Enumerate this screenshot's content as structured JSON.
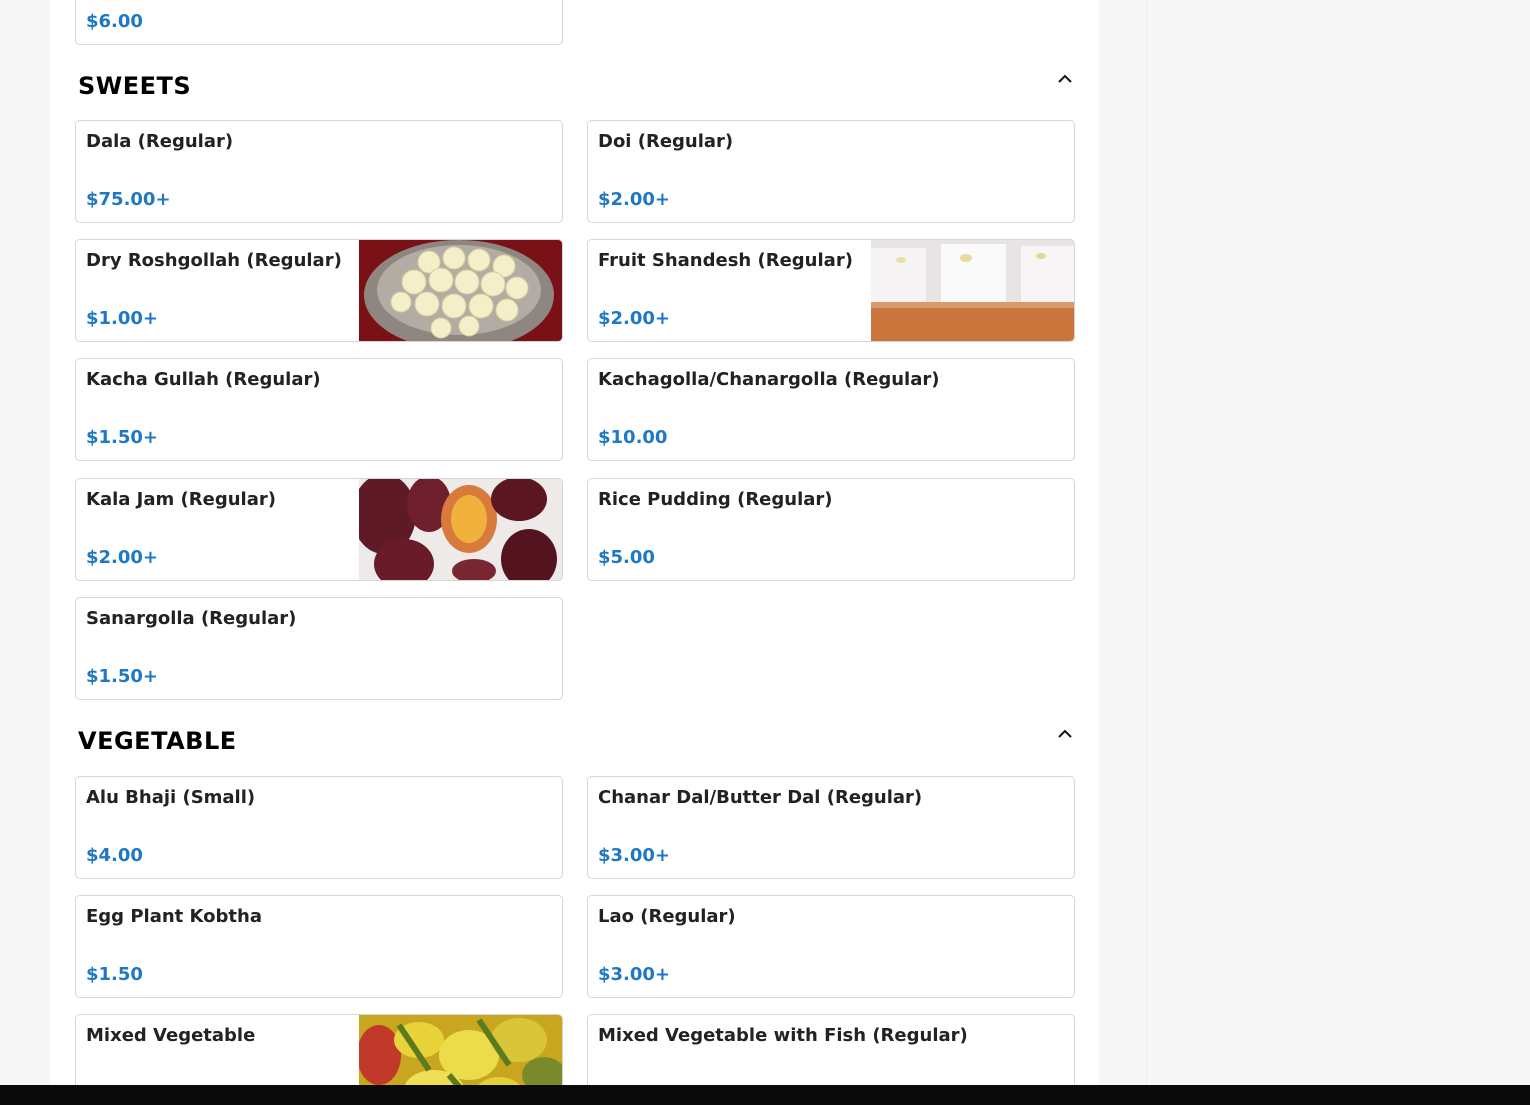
{
  "partial_top": {
    "price": "$6.00"
  },
  "sections": {
    "sweets": {
      "title": "SWEETS",
      "items": [
        {
          "name": "Dala (Regular)",
          "price": "$75.00+"
        },
        {
          "name": "Doi (Regular)",
          "price": "$2.00+"
        },
        {
          "name": "Dry Roshgollah (Regular)",
          "price": "$1.00+",
          "image": "roshgollah-photo"
        },
        {
          "name": "Fruit Shandesh (Regular)",
          "price": "$2.00+",
          "image": "shandesh-photo"
        },
        {
          "name": "Kacha Gullah (Regular)",
          "price": "$1.50+"
        },
        {
          "name": "Kachagolla/Chanargolla (Regular)",
          "price": "$10.00"
        },
        {
          "name": "Kala Jam (Regular)",
          "price": "$2.00+",
          "image": "kala-jam-photo"
        },
        {
          "name": "Rice Pudding (Regular)",
          "price": "$5.00"
        },
        {
          "name": "Sanargolla (Regular)",
          "price": "$1.50+"
        }
      ]
    },
    "vegetable": {
      "title": "VEGETABLE",
      "items": [
        {
          "name": "Alu Bhaji (Small)",
          "price": "$4.00"
        },
        {
          "name": "Chanar Dal/Butter Dal (Regular)",
          "price": "$3.00+"
        },
        {
          "name": "Egg Plant Kobtha",
          "price": "$1.50"
        },
        {
          "name": "Lao (Regular)",
          "price": "$3.00+"
        },
        {
          "name": "Mixed Vegetable",
          "price": "",
          "image": "mixed-vegetable-photo"
        },
        {
          "name": "Mixed Vegetable with Fish (Regular)",
          "price": ""
        }
      ]
    }
  },
  "colors": {
    "price": "#1f78c4",
    "card_border": "#d6d6d6",
    "page_bg": "#f7f7f7"
  },
  "icons": {
    "collapse": "chevron-up-icon"
  }
}
